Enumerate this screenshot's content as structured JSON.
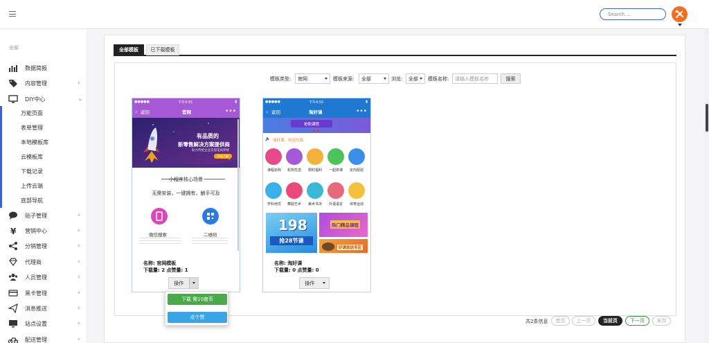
{
  "header": {
    "search_placeholder": "Search ..."
  },
  "sidebar": {
    "section_label": "全部",
    "items": [
      {
        "label": "数据简报",
        "icon": "bar-chart-icon",
        "has_chevron": false
      },
      {
        "label": "内容管理",
        "icon": "tag-icon",
        "has_chevron": true
      },
      {
        "label": "DIY中心",
        "icon": "monitor-icon",
        "has_chevron": true,
        "expanded": true
      },
      {
        "label": "贴子管理",
        "icon": "comment-icon",
        "has_chevron": true
      },
      {
        "label": "营销中心",
        "icon": "yen-icon",
        "has_chevron": true
      },
      {
        "label": "分销管理",
        "icon": "share-icon",
        "has_chevron": true
      },
      {
        "label": "代理商",
        "icon": "diamond-icon",
        "has_chevron": true
      },
      {
        "label": "人员管理",
        "icon": "users-icon",
        "has_chevron": true
      },
      {
        "label": "黑卡管理",
        "icon": "credit-card-icon",
        "has_chevron": true
      },
      {
        "label": "消息推送",
        "icon": "paper-plane-icon",
        "has_chevron": true
      },
      {
        "label": "站点设置",
        "icon": "desktop-icon",
        "has_chevron": true
      },
      {
        "label": "配送管理",
        "icon": "motorcycle-icon",
        "has_chevron": true
      }
    ],
    "diy_subitems": [
      "万能页面",
      "表单管理",
      "本地模板库",
      "云模板库",
      "下载记录",
      "上传云端",
      "底部导航"
    ]
  },
  "tabs": [
    {
      "label": "全部模板",
      "active": true
    },
    {
      "label": "已下载模板",
      "active": false
    }
  ],
  "filters": {
    "type_label": "模板类型:",
    "type_value": "官网",
    "source_label": "模板来源:",
    "source_value": "全部",
    "browse_label": "浏览:",
    "browse_value": "全部",
    "name_label": "模板名称:",
    "name_placeholder": "请输入模板名称",
    "search_button": "搜索"
  },
  "cards": [
    {
      "time": "下午4:55",
      "back": "返回",
      "title": "官网",
      "banner_line1": "有品质的",
      "banner_line2": "新零售解决方案提供商",
      "banner_line3": "助力传统企业实现电商梦想",
      "banner_button": "开始了解",
      "section_title": "小程序核心场景",
      "slogan": "无需安装，一键拥有，触手可及",
      "features": [
        "微信搜索",
        "二维码"
      ],
      "name_line": "名称: 官网模板",
      "stats_line": "下载量: 2 点赞量: 1",
      "op_label": "操作"
    },
    {
      "time": "下午4:55",
      "back": "返回",
      "title": "淘好课",
      "banner_text": "抢购课程",
      "notice": "淘好课，欢迎光临",
      "icons_row1": [
        "课程抢购",
        "机构优选",
        "限时福利",
        "一起拼课",
        "定向经验"
      ],
      "icons_row2": [
        "学科培优",
        "舞蹈艺术",
        "美术书法",
        "外语语言",
        "体育运动"
      ],
      "promo_big": "198",
      "promo_sub": "抢28节课",
      "promo_right1": "热门精品课程",
      "promo_right2": "好课放送专区",
      "name_line": "名称: 淘好课",
      "stats_line": "下载量: 0 点赞量: 0",
      "op_label": "操作"
    }
  ],
  "dropdown": {
    "download": "下载 需10度币",
    "like": "点个赞"
  },
  "pagination": {
    "info": "共2条信息",
    "first": "首页",
    "prev": "上一页",
    "current": "当前页",
    "next": "下一页",
    "last": "末页"
  },
  "colors": {
    "accent": "#3b63d6",
    "avatar": "#f36f1e",
    "card1_header": "#a658d6",
    "card2_header": "#1f78d1",
    "download_btn": "#4aaa4a",
    "like_btn": "#3aa4e8",
    "next_green": "#2e9e3b"
  }
}
